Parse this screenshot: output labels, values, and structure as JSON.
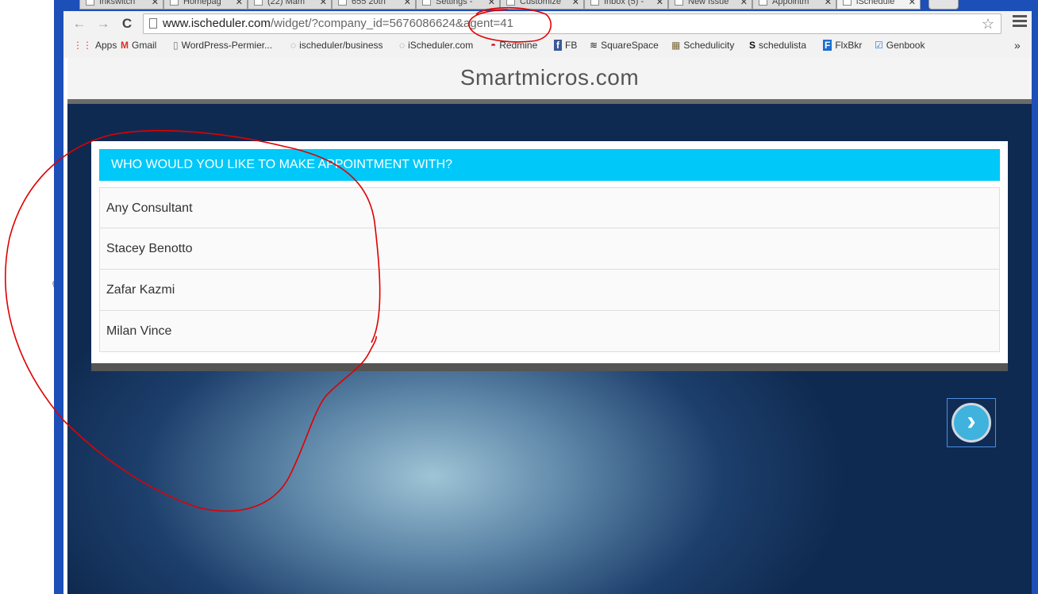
{
  "browser": {
    "tabs": [
      {
        "label": "Inkswitch",
        "active": false
      },
      {
        "label": "Homepag",
        "active": false
      },
      {
        "label": "(22) Mam",
        "active": false
      },
      {
        "label": "655 20th",
        "active": false
      },
      {
        "label": "Settings -",
        "active": false
      },
      {
        "label": "Customize",
        "active": false
      },
      {
        "label": "Inbox (5) -",
        "active": false
      },
      {
        "label": "New Issue",
        "active": false
      },
      {
        "label": "Appointm",
        "active": false
      },
      {
        "label": "iSchedule",
        "active": true
      }
    ],
    "close_glyph": "✕",
    "back_glyph": "←",
    "forward_glyph": "→",
    "reload_glyph": "C",
    "url_host": "www.ischeduler.com",
    "url_path": "/widget/?company_id=5676086624&agent=41",
    "star_glyph": "☆",
    "bookmarks": [
      {
        "label": "Apps",
        "icon": "apps-grid-icon",
        "glyph": "⋮⋮"
      },
      {
        "label": "Gmail",
        "icon": "gmail-icon",
        "glyph": "M"
      },
      {
        "label": "WordPress-Permier...",
        "icon": "page-icon",
        "glyph": "▯"
      },
      {
        "label": "ischeduler/business",
        "icon": "ischeduler-icon",
        "glyph": "◌"
      },
      {
        "label": "iScheduler.com",
        "icon": "ischeduler-icon",
        "glyph": "◌"
      },
      {
        "label": "Redmine",
        "icon": "redmine-icon",
        "glyph": "◓"
      },
      {
        "label": "FB",
        "icon": "facebook-icon",
        "glyph": "f"
      },
      {
        "label": "SquareSpace",
        "icon": "squarespace-icon",
        "glyph": "≋"
      },
      {
        "label": "Schedulicity",
        "icon": "schedulicity-icon",
        "glyph": "▦"
      },
      {
        "label": "schedulista",
        "icon": "schedulista-icon",
        "glyph": "S"
      },
      {
        "label": "FlxBkr",
        "icon": "flxbkr-icon",
        "glyph": "F"
      },
      {
        "label": "Genbook",
        "icon": "genbook-icon",
        "glyph": "☑"
      }
    ],
    "more_glyph": "»"
  },
  "left_fragment": "g",
  "site": {
    "brand": "Smartmicros.com"
  },
  "widget": {
    "heading": "WHO WOULD YOU LIKE TO MAKE APPOINTMENT WITH?",
    "options": [
      "Any Consultant",
      "Stacey Benotto",
      "Zafar Kazmi",
      "Milan Vince"
    ],
    "next_glyph": "›"
  },
  "colors": {
    "header_bar": "#00c8f8",
    "annotation": "#e00000",
    "window_frame": "#1d4fb8"
  }
}
